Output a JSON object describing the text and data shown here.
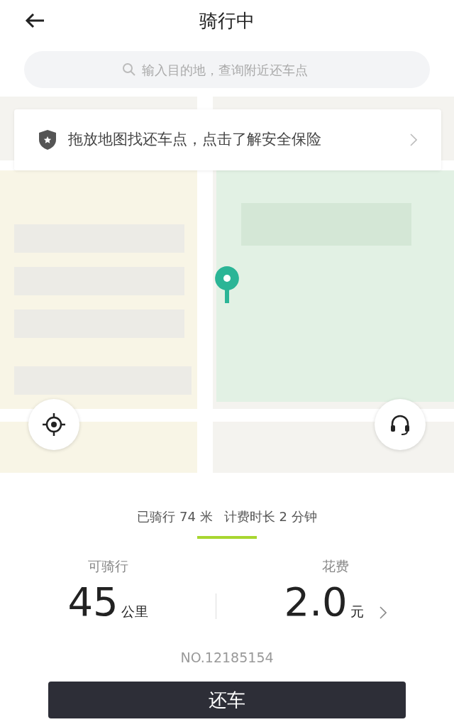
{
  "header": {
    "title": "骑行中"
  },
  "search": {
    "placeholder": "输入目的地，查询附近还车点"
  },
  "notice": {
    "text": "拖放地图找还车点，点击了解安全保险"
  },
  "trip": {
    "distance": "已骑行 74 米",
    "duration": "计费时长 2 分钟"
  },
  "stats": [
    {
      "kind": "plain",
      "label": "可骑行",
      "value": "45",
      "unit": "公里"
    },
    {
      "kind": "link",
      "label": "花费",
      "value": "2.0",
      "unit": "元"
    }
  ],
  "bike_number": "NO.12185154",
  "action_button": "还车"
}
